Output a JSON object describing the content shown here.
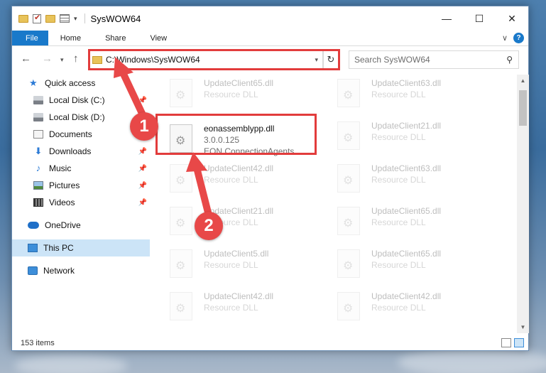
{
  "window": {
    "title": "SysWOW64"
  },
  "controls": {
    "minimize": "—",
    "maximize": "☐",
    "close": "✕"
  },
  "ribbon": {
    "tabs": [
      "File",
      "Home",
      "Share",
      "View"
    ],
    "help": "?"
  },
  "address": {
    "path": "C:\\Windows\\SysWOW64"
  },
  "search": {
    "placeholder": "Search SysWOW64"
  },
  "nav": {
    "items": [
      {
        "label": "Quick access"
      },
      {
        "label": "Local Disk (C:)"
      },
      {
        "label": "Local Disk (D:)"
      },
      {
        "label": "Documents"
      },
      {
        "label": "Downloads"
      },
      {
        "label": "Music"
      },
      {
        "label": "Pictures"
      },
      {
        "label": "Videos"
      },
      {
        "label": "OneDrive"
      },
      {
        "label": "This PC"
      },
      {
        "label": "Network"
      }
    ]
  },
  "files": [
    {
      "name": "UpdateClient65.dll",
      "desc": "Resource DLL"
    },
    {
      "name": "UpdateClient63.dll",
      "desc": "Resource DLL"
    },
    {
      "name": "eonassemblypp.dll",
      "desc": "3.0.0.125",
      "desc2": "EON ConnectionAgents"
    },
    {
      "name": "UpdateClient21.dll",
      "desc": "Resource DLL"
    },
    {
      "name": "UpdateClient42.dll",
      "desc": "Resource DLL"
    },
    {
      "name": "UpdateClient63.dll",
      "desc": "Resource DLL"
    },
    {
      "name": "UpdateClient21.dll",
      "desc": "Resource DLL"
    },
    {
      "name": "UpdateClient65.dll",
      "desc": "Resource DLL"
    },
    {
      "name": "UpdateClient5.dll",
      "desc": "Resource DLL"
    },
    {
      "name": "UpdateClient65.dll",
      "desc": "Resource DLL"
    },
    {
      "name": "UpdateClient42.dll",
      "desc": "Resource DLL"
    },
    {
      "name": "UpdateClient42.dll",
      "desc": "Resource DLL"
    }
  ],
  "status": {
    "count": "153 items"
  },
  "annotations": {
    "step1": "1",
    "step2": "2"
  },
  "colors": {
    "accent": "#1979ca",
    "highlight": "#e23c3c",
    "badge": "#e84848"
  }
}
